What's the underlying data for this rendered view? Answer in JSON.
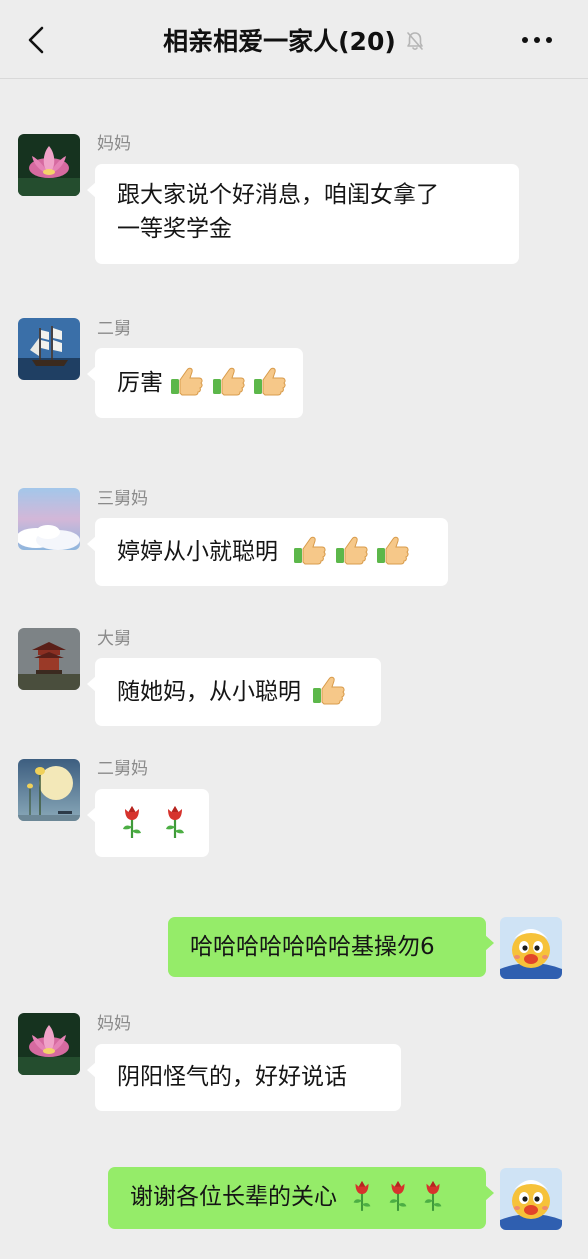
{
  "header": {
    "title": "相亲相爱一家人(20)",
    "back_icon": "chevron-left-icon",
    "mute_icon": "bell-off-icon",
    "more_icon": "more-dots-icon"
  },
  "colors": {
    "background": "#ededed",
    "bubble_other": "#ffffff",
    "bubble_self": "#95ec69",
    "sender_name": "#8a8a8a"
  },
  "messages": [
    {
      "side": "left",
      "sender": "妈妈",
      "avatar": "lotus-avatar",
      "lines": [
        "跟大家说个好消息，咱闺女拿了",
        "一等奖学金"
      ]
    },
    {
      "side": "left",
      "sender": "二舅",
      "avatar": "sailing-ship-avatar",
      "text": "厉害",
      "emojis": [
        "thumbs-up-icon",
        "thumbs-up-icon",
        "thumbs-up-icon"
      ]
    },
    {
      "side": "left",
      "sender": "三舅妈",
      "avatar": "sky-clouds-avatar",
      "text": "婷婷从小就聪明",
      "emojis": [
        "thumbs-up-icon",
        "thumbs-up-icon",
        "thumbs-up-icon"
      ]
    },
    {
      "side": "left",
      "sender": "大舅",
      "avatar": "pavilion-avatar",
      "text": "随她妈，从小聪明",
      "emojis": [
        "thumbs-up-icon"
      ]
    },
    {
      "side": "left",
      "sender": "二舅妈",
      "avatar": "moon-lotus-avatar",
      "text": "",
      "emojis": [
        "rose-icon",
        "rose-icon"
      ]
    },
    {
      "side": "right",
      "sender": "",
      "avatar": "cartoon-duck-avatar",
      "text": "哈哈哈哈哈哈哈基操勿6"
    },
    {
      "side": "left",
      "sender": "妈妈",
      "avatar": "lotus-avatar",
      "text": "阴阳怪气的，好好说话"
    },
    {
      "side": "right",
      "sender": "",
      "avatar": "cartoon-duck-avatar",
      "text": "谢谢各位长辈的关心",
      "emojis": [
        "rose-icon",
        "rose-icon",
        "rose-icon"
      ]
    }
  ]
}
